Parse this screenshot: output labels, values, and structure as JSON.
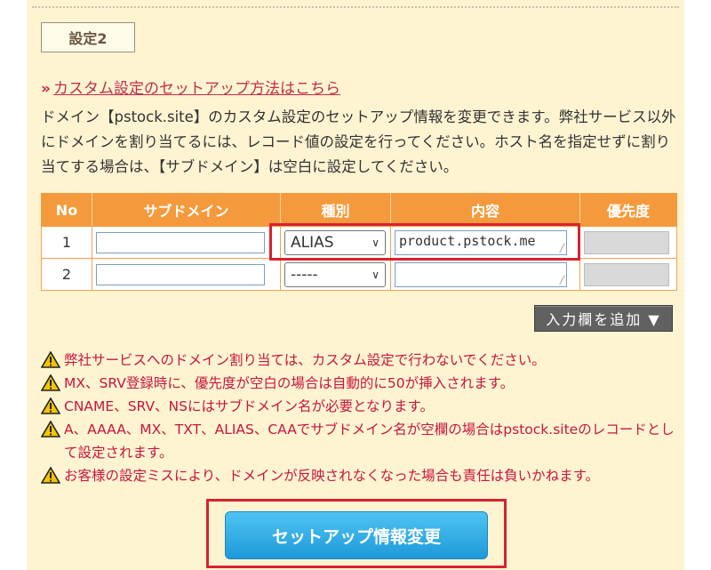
{
  "section_label": "設定2",
  "setup_link": {
    "arrow": "»",
    "text": "カスタム設定のセットアップ方法はこちら"
  },
  "description": "ドメイン【pstock.site】のカスタム設定のセットアップ情報を変更できます。弊社サービス以外にドメインを割り当てるには、レコード値の設定を行ってください。ホスト名を指定せずに割り当てする場合は、【サブドメイン】は空白に設定してください。",
  "table": {
    "headers": [
      "No",
      "サブドメイン",
      "種別",
      "内容",
      "優先度"
    ],
    "rows": [
      {
        "no": "1",
        "subdomain": "",
        "type": "ALIAS",
        "content": "product.pstock.me",
        "priority": ""
      },
      {
        "no": "2",
        "subdomain": "",
        "type": "-----",
        "content": "",
        "priority": ""
      }
    ]
  },
  "add_button": "入力欄を追加 ▼",
  "notes": [
    "弊社サービスへのドメイン割り当ては、カスタム設定で行わないでください。",
    "MX、SRV登録時に、優先度が空白の場合は自動的に50が挿入されます。",
    "CNAME、SRV、NSにはサブドメイン名が必要となります。",
    "A、AAAA、MX、TXT、ALIAS、CAAでサブドメイン名が空欄の場合はpstock.siteのレコードとして設定されます。",
    "お客様の設定ミスにより、ドメインが反映されなくなった場合も責任は負いかねます。"
  ],
  "submit_button": "セットアップ情報変更",
  "colors": {
    "panel_bg": "#fef4d2",
    "header_orange": "#f59a3c",
    "warning_red": "#c8163e",
    "highlight_red": "#d8222e",
    "submit_blue": "#1e9ad9"
  }
}
